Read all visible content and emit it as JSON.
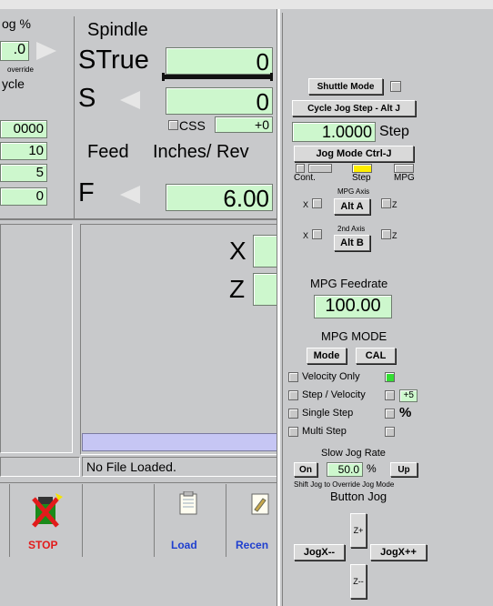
{
  "top_left": {
    "jog_pct_label": "og %",
    "jog_pct_value": ".0",
    "override_label": "override",
    "cycle_label": "ycle",
    "values": [
      "0000",
      "10",
      "5",
      "0"
    ]
  },
  "spindle": {
    "title": "Spindle",
    "strue_label": "STrue",
    "strue_value": "0",
    "s_label": "S",
    "s_value": "0",
    "css_label": "CSS",
    "css_value": "+0"
  },
  "feed": {
    "title": "Feed",
    "units": "Inches/ Rev",
    "f_label": "F",
    "f_value": "6.00"
  },
  "axes": [
    {
      "label": "X"
    },
    {
      "label": "Z"
    }
  ],
  "file_status": "No File Loaded.",
  "toolbar": {
    "stop_label": "STOP",
    "load_label": "Load",
    "recent_label": "Recen"
  },
  "jog_panel": {
    "shuttle_mode": "Shuttle Mode",
    "cycle_jog_step": "Cycle Jog Step - Alt J",
    "step_value": "1.0000",
    "step_label": "Step",
    "jog_mode": "Jog Mode Ctrl-J",
    "mode_cont": "Cont.",
    "mode_step": "Step",
    "mode_mpg": "MPG",
    "x1": "X",
    "mpg_axis_label": "MPG Axis",
    "alt_a": "Alt A",
    "z1": "Z",
    "x2": "X",
    "axis2_label": "2nd Axis",
    "alt_b": "Alt B",
    "z2": "Z",
    "mpg_feedrate_label": "MPG Feedrate",
    "mpg_feedrate_value": "100.00",
    "mpg_mode_label": "MPG MODE",
    "mode_btn": "Mode",
    "cal_btn": "CAL",
    "velocity_only": "Velocity Only",
    "step_velocity": "Step / Velocity",
    "step_velocity_value": "+5",
    "single_step": "Single Step",
    "percent": "%",
    "multi_step": "Multi Step",
    "slow_jog_rate": "Slow Jog Rate",
    "slow_on": "On",
    "slow_value": "50.0",
    "slow_pct": "%",
    "slow_up": "Up",
    "shift_note": "Shift Jog to Override Jog Mode",
    "button_jog": "Button Jog",
    "z_plus": "Z+",
    "jog_x_minus": "JogX--",
    "jog_x_plus": "JogX++",
    "z_minus": "Z--"
  },
  "colors": {
    "lcd": "#cdf7cd",
    "led_green": "#33dd33",
    "led_yellow": "#ffee00",
    "progress_bar": "#c6c6f4",
    "stop_red": "#e21b1b"
  }
}
